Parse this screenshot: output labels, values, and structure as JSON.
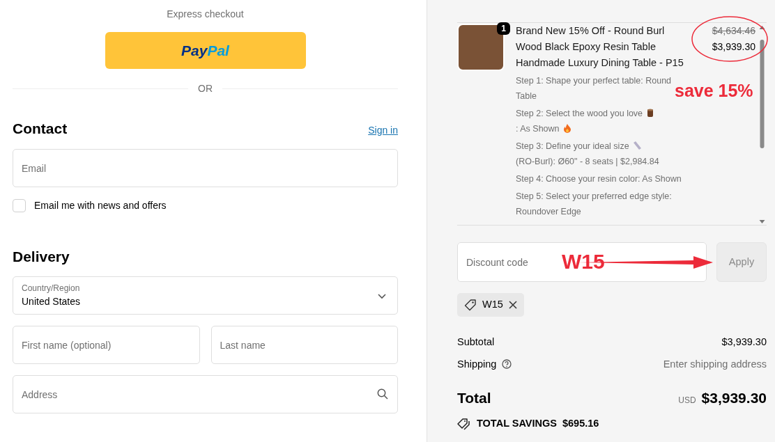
{
  "express": {
    "title": "Express checkout",
    "paypal": {
      "pay": "Pay",
      "pal": "Pal"
    },
    "divider": "OR"
  },
  "contact": {
    "heading": "Contact",
    "sign_in": "Sign in",
    "email": {
      "placeholder": "Email"
    },
    "newsletter": {
      "label": "Email me with news and offers",
      "checked": false
    }
  },
  "delivery": {
    "heading": "Delivery",
    "country": {
      "label": "Country/Region",
      "value": "United States"
    },
    "first_name": {
      "placeholder": "First name (optional)"
    },
    "last_name": {
      "placeholder": "Last name"
    },
    "address": {
      "placeholder": "Address"
    }
  },
  "order": {
    "items": [
      {
        "quantity": "1",
        "title": "Brand New 15% Off - Round Burl Wood Black Epoxy Resin Table Handmade Luxury Dining Table - P15",
        "original_price": "$4,634.46",
        "price": "$3,939.30",
        "options": [
          {
            "parts": [
              "Step 1: Shape your perfect table: Round Table"
            ]
          },
          {
            "parts": [
              "Step 2: Select the wood you love",
              ": As Shown"
            ]
          },
          {
            "parts": [
              "Step 3: Define your ideal size",
              "(RO-Burl): Ø60\" - 8 seats | $2,984.84"
            ]
          },
          {
            "parts": [
              "Step 4: Choose your resin color: As Shown"
            ]
          },
          {
            "parts": [
              "Step 5: Select your preferred edge style: Roundover Edge"
            ]
          }
        ]
      }
    ]
  },
  "discount": {
    "placeholder": "Discount code",
    "button": "Apply",
    "applied": [
      {
        "code": "W15"
      }
    ]
  },
  "summary": {
    "subtotal_label": "Subtotal",
    "subtotal": "$3,939.30",
    "shipping_label": "Shipping",
    "shipping": "Enter shipping address",
    "total_label": "Total",
    "currency": "USD",
    "total": "$3,939.30",
    "savings_label": "TOTAL SAVINGS",
    "savings": "$695.16"
  },
  "annotations": [
    {
      "kind": "callout",
      "text": "save 15%"
    },
    {
      "kind": "code",
      "text": "W15"
    }
  ]
}
